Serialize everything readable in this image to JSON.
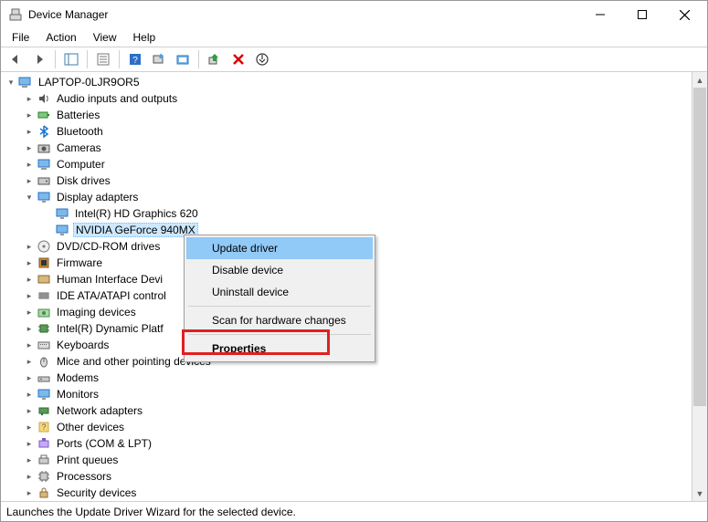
{
  "window": {
    "title": "Device Manager"
  },
  "menubar": {
    "file": "File",
    "action": "Action",
    "view": "View",
    "help": "Help"
  },
  "tree": {
    "root": "LAPTOP-0LJR9OR5",
    "audio": "Audio inputs and outputs",
    "batteries": "Batteries",
    "bluetooth": "Bluetooth",
    "cameras": "Cameras",
    "computer": "Computer",
    "disk": "Disk drives",
    "display": "Display adapters",
    "display_intel": "Intel(R) HD Graphics 620",
    "display_nvidia": "NVIDIA GeForce 940MX",
    "dvd": "DVD/CD-ROM drives",
    "firmware": "Firmware",
    "hid": "Human Interface Devi",
    "ide": "IDE ATA/ATAPI control",
    "imaging": "Imaging devices",
    "intel_dpt": "Intel(R) Dynamic Platf",
    "keyboards": "Keyboards",
    "mice": "Mice and other pointing devices",
    "modems": "Modems",
    "monitors": "Monitors",
    "network": "Network adapters",
    "other": "Other devices",
    "ports": "Ports (COM & LPT)",
    "printq": "Print queues",
    "processors": "Processors",
    "security": "Security devices"
  },
  "context_menu": {
    "update_driver": "Update driver",
    "disable_device": "Disable device",
    "uninstall_device": "Uninstall device",
    "scan_hw": "Scan for hardware changes",
    "properties": "Properties"
  },
  "statusbar": {
    "text": "Launches the Update Driver Wizard for the selected device."
  }
}
